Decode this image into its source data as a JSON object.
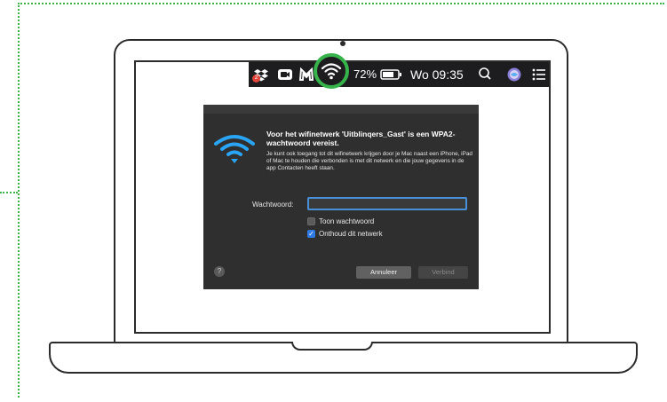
{
  "menubar": {
    "battery_text": "72%",
    "clock": "Wo 09:35",
    "dropbox_badge": "2",
    "icons": [
      "dropbox-icon",
      "zoom-icon",
      "malwarebytes-icon",
      "wifi-icon",
      "battery-icon",
      "search-icon",
      "siri-icon",
      "notification-center-icon"
    ]
  },
  "dialog": {
    "title": "Voor het wifinetwerk 'Uitblinqers_Gast' is een WPA2-wachtwoord vereist.",
    "body": "Je kunt ook toegang tot dit wifinetwerk krijgen door je Mac naast een iPhone, iPad of Mac te houden die verbonden is met dit netwerk en die jouw gegevens in de app Contacten heeft staan.",
    "password_label": "Wachtwoord:",
    "password_value": "",
    "show_password_label": "Toon wachtwoord",
    "show_password_checked": false,
    "remember_label": "Onthoud dit netwerk",
    "remember_checked": true,
    "help_label": "?",
    "cancel_label": "Annuleer",
    "connect_label": "Verbind"
  },
  "colors": {
    "highlight_ring": "#36b34a",
    "guide_dots": "#3cb44a",
    "dialog_bg": "#2f2f2f",
    "wifi_blue": "#2aa4f4",
    "menubar_bg": "#1d1d1f"
  }
}
